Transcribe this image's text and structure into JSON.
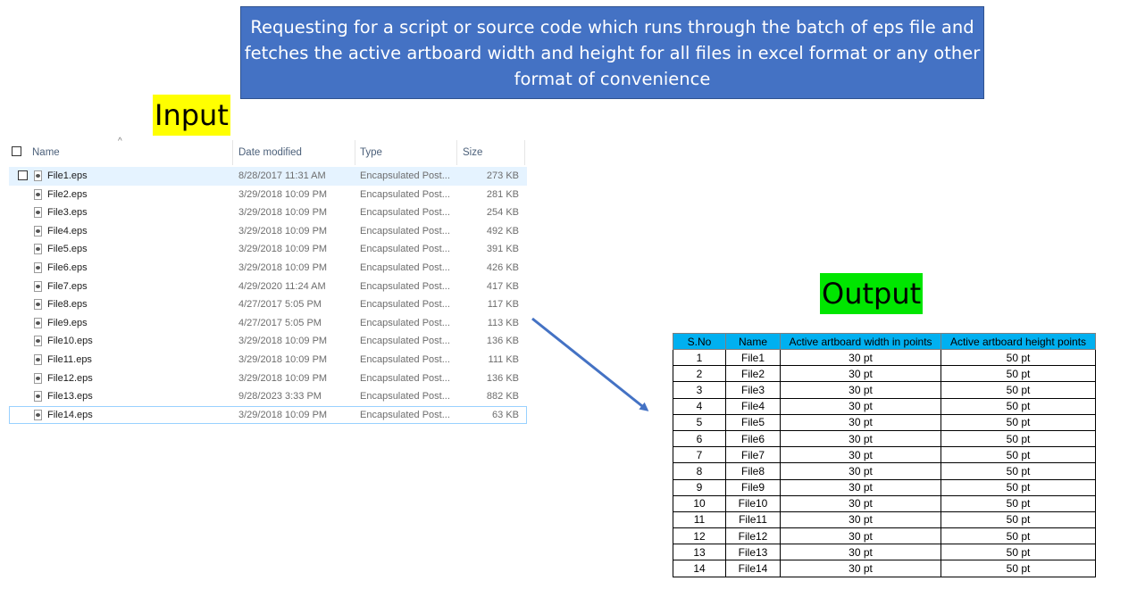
{
  "banner": {
    "text": "Requesting for a script or source code which runs through the batch of eps file and fetches the active artboard width and height for all files in excel format or any other format of convenience"
  },
  "labels": {
    "input": "Input",
    "output": "Output"
  },
  "explorer": {
    "columns": {
      "name": "Name",
      "date": "Date modified",
      "type": "Type",
      "size": "Size"
    },
    "files": [
      {
        "name": "File1.eps",
        "date": "8/28/2017 11:31 AM",
        "type": "Encapsulated Post...",
        "size": "273 KB"
      },
      {
        "name": "File2.eps",
        "date": "3/29/2018 10:09 PM",
        "type": "Encapsulated Post...",
        "size": "281 KB"
      },
      {
        "name": "File3.eps",
        "date": "3/29/2018 10:09 PM",
        "type": "Encapsulated Post...",
        "size": "254 KB"
      },
      {
        "name": "File4.eps",
        "date": "3/29/2018 10:09 PM",
        "type": "Encapsulated Post...",
        "size": "492 KB"
      },
      {
        "name": "File5.eps",
        "date": "3/29/2018 10:09 PM",
        "type": "Encapsulated Post...",
        "size": "391 KB"
      },
      {
        "name": "File6.eps",
        "date": "3/29/2018 10:09 PM",
        "type": "Encapsulated Post...",
        "size": "426 KB"
      },
      {
        "name": "File7.eps",
        "date": "4/29/2020 11:24 AM",
        "type": "Encapsulated Post...",
        "size": "417 KB"
      },
      {
        "name": "File8.eps",
        "date": "4/27/2017 5:05 PM",
        "type": "Encapsulated Post...",
        "size": "117 KB"
      },
      {
        "name": "File9.eps",
        "date": "4/27/2017 5:05 PM",
        "type": "Encapsulated Post...",
        "size": "113 KB"
      },
      {
        "name": "File10.eps",
        "date": "3/29/2018 10:09 PM",
        "type": "Encapsulated Post...",
        "size": "136 KB"
      },
      {
        "name": "File11.eps",
        "date": "3/29/2018 10:09 PM",
        "type": "Encapsulated Post...",
        "size": "111 KB"
      },
      {
        "name": "File12.eps",
        "date": "3/29/2018 10:09 PM",
        "type": "Encapsulated Post...",
        "size": "136 KB"
      },
      {
        "name": "File13.eps",
        "date": "9/28/2023 3:33 PM",
        "type": "Encapsulated Post...",
        "size": "882 KB"
      },
      {
        "name": "File14.eps",
        "date": "3/29/2018 10:09 PM",
        "type": "Encapsulated Post...",
        "size": "63 KB"
      }
    ]
  },
  "table": {
    "headers": [
      "S.No",
      "Name",
      "Active artboard width in points",
      "Active artboard height points"
    ],
    "rows": [
      [
        "1",
        "File1",
        "30 pt",
        "50 pt"
      ],
      [
        "2",
        "File2",
        "30 pt",
        "50 pt"
      ],
      [
        "3",
        "File3",
        "30 pt",
        "50 pt"
      ],
      [
        "4",
        "File4",
        "30 pt",
        "50 pt"
      ],
      [
        "5",
        "File5",
        "30 pt",
        "50 pt"
      ],
      [
        "6",
        "File6",
        "30 pt",
        "50 pt"
      ],
      [
        "7",
        "File7",
        "30 pt",
        "50 pt"
      ],
      [
        "8",
        "File8",
        "30 pt",
        "50 pt"
      ],
      [
        "9",
        "File9",
        "30 pt",
        "50 pt"
      ],
      [
        "10",
        "File10",
        "30 pt",
        "50 pt"
      ],
      [
        "11",
        "File11",
        "30 pt",
        "50 pt"
      ],
      [
        "12",
        "File12",
        "30 pt",
        "50 pt"
      ],
      [
        "13",
        "File13",
        "30 pt",
        "50 pt"
      ],
      [
        "14",
        "File14",
        "30 pt",
        "50 pt"
      ]
    ]
  },
  "colors": {
    "banner": "#4472c4",
    "input_highlight": "#ffff00",
    "output_highlight": "#00e600",
    "table_header": "#00b0f0",
    "arrow": "#4472c4"
  }
}
